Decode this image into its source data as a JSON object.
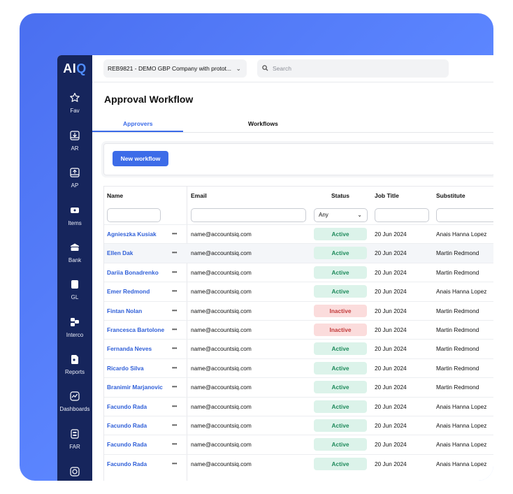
{
  "brand": {
    "logo_a": "AI",
    "logo_q": "Q"
  },
  "sidebar": {
    "items": [
      {
        "label": "Fav",
        "icon": "star-icon"
      },
      {
        "label": "AR",
        "icon": "inbox-download-icon"
      },
      {
        "label": "AP",
        "icon": "inbox-upload-icon"
      },
      {
        "label": "Items",
        "icon": "ticket-icon"
      },
      {
        "label": "Bank",
        "icon": "bank-icon"
      },
      {
        "label": "GL",
        "icon": "ledger-icon"
      },
      {
        "label": "Interco",
        "icon": "interco-icon"
      },
      {
        "label": "Reports",
        "icon": "report-icon"
      },
      {
        "label": "Dashboards",
        "icon": "dashboard-icon"
      },
      {
        "label": "FAR",
        "icon": "far-icon"
      },
      {
        "label": "",
        "icon": "globe-icon"
      }
    ]
  },
  "topbar": {
    "company": "REB9821 - DEMO GBP Company with protot...",
    "search_placeholder": "Search"
  },
  "page": {
    "title": "Approval Workflow"
  },
  "tabs": [
    {
      "label": "Approvers",
      "active": true
    },
    {
      "label": "Workflows",
      "active": false
    }
  ],
  "toolbar": {
    "new_workflow": "New workflow"
  },
  "table": {
    "columns": [
      "Name",
      "Email",
      "Status",
      "Job Title",
      "Substitute"
    ],
    "status_filter": "Any",
    "more_glyph": "•••",
    "rows": [
      {
        "name": "Agnieszka Kusiak",
        "email": "name@accountsiq.com",
        "status": "Active",
        "job_title": "20 Jun 2024",
        "substitute": "Anais Hanna Lopez"
      },
      {
        "name": "Ellen Dak",
        "email": "name@accountsiq.com",
        "status": "Active",
        "job_title": "20 Jun 2024",
        "substitute": "Martin Redmond"
      },
      {
        "name": "Dariia Bonadrenko",
        "email": "name@accountsiq.com",
        "status": "Active",
        "job_title": "20 Jun 2024",
        "substitute": "Martin Redmond"
      },
      {
        "name": "Emer Redmond",
        "email": "name@accountsiq.com",
        "status": "Active",
        "job_title": "20 Jun 2024",
        "substitute": "Anais Hanna Lopez"
      },
      {
        "name": "Fintan Nolan",
        "email": "name@accountsiq.com",
        "status": "Inactive",
        "job_title": "20 Jun 2024",
        "substitute": "Martin Redmond"
      },
      {
        "name": "Francesca Bartolone",
        "email": "name@accountsiq.com",
        "status": "Inactive",
        "job_title": "20 Jun 2024",
        "substitute": "Martin Redmond"
      },
      {
        "name": "Fernanda Neves",
        "email": "name@accountsiq.com",
        "status": "Active",
        "job_title": "20 Jun 2024",
        "substitute": "Martin Redmond"
      },
      {
        "name": "Ricardo Silva",
        "email": "name@accountsiq.com",
        "status": "Active",
        "job_title": "20 Jun 2024",
        "substitute": "Martin Redmond"
      },
      {
        "name": "Branimir Marjanovic",
        "email": "name@accountsiq.com",
        "status": "Active",
        "job_title": "20 Jun 2024",
        "substitute": "Martin Redmond"
      },
      {
        "name": "Facundo Rada",
        "email": "name@accountsiq.com",
        "status": "Active",
        "job_title": "20 Jun 2024",
        "substitute": "Anais Hanna Lopez"
      },
      {
        "name": "Facundo Rada",
        "email": "name@accountsiq.com",
        "status": "Active",
        "job_title": "20 Jun 2024",
        "substitute": "Anais Hanna Lopez"
      },
      {
        "name": "Facundo Rada",
        "email": "name@accountsiq.com",
        "status": "Active",
        "job_title": "20 Jun 2024",
        "substitute": "Anais Hanna Lopez"
      },
      {
        "name": "Facundo Rada",
        "email": "name@accountsiq.com",
        "status": "Active",
        "job_title": "20 Jun 2024",
        "substitute": "Anais Hanna Lopez"
      }
    ]
  },
  "colors": {
    "accent": "#3d6ce8",
    "sidebar": "#16255c",
    "active_bg": "#dcf3ea",
    "inactive_bg": "#fbdcdc"
  }
}
